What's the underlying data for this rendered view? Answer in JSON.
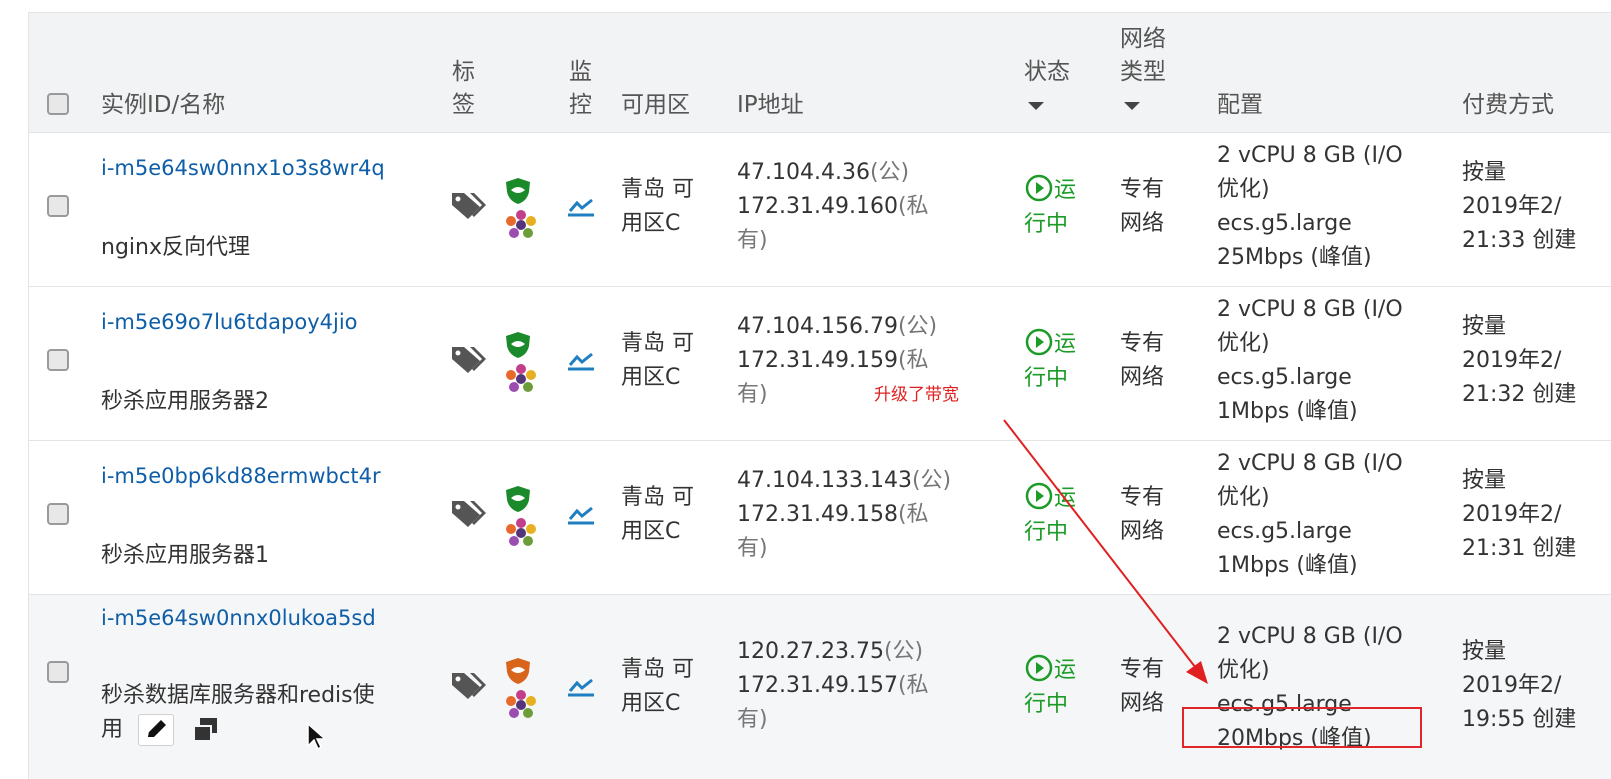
{
  "header": {
    "id_name": "实例ID/名称",
    "tags_l1": "标",
    "tags_l2": "签",
    "monitor_l1": "监",
    "monitor_l2": "控",
    "zone": "可用区",
    "ip": "IP地址",
    "status": "状态",
    "network_l1": "网络",
    "network_l2": "类型",
    "config": "配置",
    "billing": "付费方式"
  },
  "rows": [
    {
      "id": "i-m5e64sw0nnx1o3s8wr4q",
      "name": "nginx反向代理",
      "zone_l1": "青岛 可",
      "zone_l2": "用区C",
      "ip_public": "47.104.4.36",
      "ip_public_kind": "(公)",
      "ip_private": "172.31.49.160",
      "ip_private_kind_l1": "(私",
      "ip_private_kind_l2": "有)",
      "status_l1": "运",
      "status_l2": "行中",
      "network_l1": "专有",
      "network_l2": "网络",
      "config_l1": "2 vCPU 8 GB (I/O",
      "config_l2": "优化)",
      "config_l3": "ecs.g5.large",
      "config_l4": "25Mbps (峰值)",
      "billing_l1": "按量",
      "billing_l2": "2019年2/",
      "billing_l3": "21:33 创建",
      "shield_color": "#1a8a2a"
    },
    {
      "id": "i-m5e69o7lu6tdapoy4jio",
      "name": "秒杀应用服务器2",
      "zone_l1": "青岛 可",
      "zone_l2": "用区C",
      "ip_public": "47.104.156.79",
      "ip_public_kind": "(公)",
      "ip_private": "172.31.49.159",
      "ip_private_kind_l1": "(私",
      "ip_private_kind_l2": "有)",
      "status_l1": "运",
      "status_l2": "行中",
      "network_l1": "专有",
      "network_l2": "网络",
      "config_l1": "2 vCPU 8 GB (I/O",
      "config_l2": "优化)",
      "config_l3": "ecs.g5.large",
      "config_l4": "1Mbps (峰值)",
      "billing_l1": "按量",
      "billing_l2": "2019年2/",
      "billing_l3": "21:32 创建",
      "shield_color": "#1a8a2a"
    },
    {
      "id": "i-m5e0bp6kd88ermwbct4r",
      "name": "秒杀应用服务器1",
      "zone_l1": "青岛 可",
      "zone_l2": "用区C",
      "ip_public": "47.104.133.143",
      "ip_public_kind": "(公)",
      "ip_private": "172.31.49.158",
      "ip_private_kind_l1": "(私",
      "ip_private_kind_l2": "有)",
      "status_l1": "运",
      "status_l2": "行中",
      "network_l1": "专有",
      "network_l2": "网络",
      "config_l1": "2 vCPU 8 GB (I/O",
      "config_l2": "优化)",
      "config_l3": "ecs.g5.large",
      "config_l4": "1Mbps (峰值)",
      "billing_l1": "按量",
      "billing_l2": "2019年2/",
      "billing_l3": "21:31 创建",
      "shield_color": "#1a8a2a"
    },
    {
      "id": "i-m5e64sw0nnx0lukoa5sd",
      "name_l1": "秒杀数据库服务器和redis使",
      "name_l2": "用",
      "zone_l1": "青岛 可",
      "zone_l2": "用区C",
      "ip_public": "120.27.23.75",
      "ip_public_kind": "(公)",
      "ip_private": "172.31.49.157",
      "ip_private_kind_l1": "(私",
      "ip_private_kind_l2": "有)",
      "status_l1": "运",
      "status_l2": "行中",
      "network_l1": "专有",
      "network_l2": "网络",
      "config_l1": "2 vCPU 8 GB (I/O",
      "config_l2": "优化)",
      "config_l3": "ecs.g5.large",
      "config_l4": "20Mbps (峰值)",
      "billing_l1": "按量",
      "billing_l2": "2019年2/",
      "billing_l3": "19:55 创建",
      "shield_color": "#d9641c"
    }
  ],
  "annotation": {
    "text": "升级了带宽",
    "color": "#e02020"
  },
  "colors": {
    "link": "#0e5ea8",
    "running": "#1c9b27",
    "monitor": "#1f7fc0"
  }
}
